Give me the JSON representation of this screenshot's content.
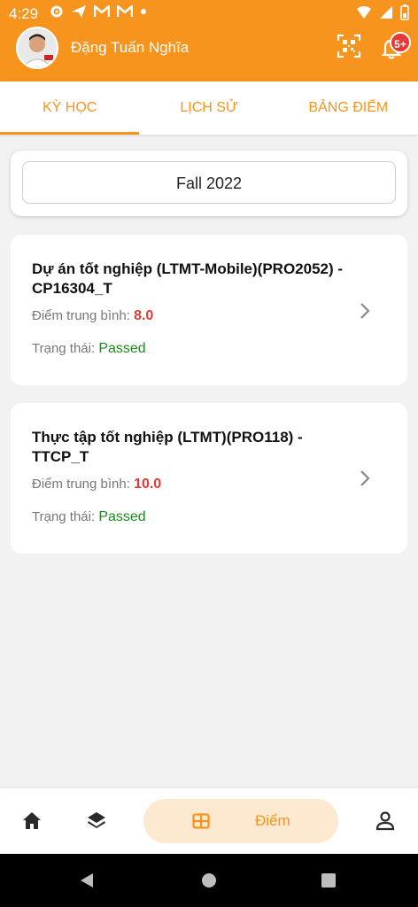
{
  "status_bar": {
    "time": "4:29"
  },
  "header": {
    "user_name": "Đặng Tuấn Nghĩa",
    "notification_badge": "5+",
    "accent_color": "#f7941d"
  },
  "tabs": [
    {
      "label": "KỲ HỌC",
      "active": true
    },
    {
      "label": "LỊCH SỬ",
      "active": false
    },
    {
      "label": "BẢNG ĐIỂM",
      "active": false
    }
  ],
  "semester": {
    "selected": "Fall 2022"
  },
  "courses": [
    {
      "title": "Dự án tốt nghiệp (LTMT-Mobile)(PRO2052) -  CP16304_T",
      "avg_label": "Điểm trung bình: ",
      "avg_value": "8.0",
      "status_label": "Trạng thái: ",
      "status_value": "Passed"
    },
    {
      "title": "Thực tập tốt nghiệp (LTMT)(PRO118) - TTCP_T",
      "avg_label": "Điểm trung bình: ",
      "avg_value": "10.0",
      "status_label": "Trạng thái: ",
      "status_value": "Passed"
    }
  ],
  "bottom_nav": {
    "items": [
      {
        "icon": "home-icon"
      },
      {
        "icon": "layers-icon"
      },
      {
        "icon": "grid-icon",
        "label": "Điểm",
        "active": true
      },
      {
        "icon": "user-icon"
      }
    ]
  }
}
